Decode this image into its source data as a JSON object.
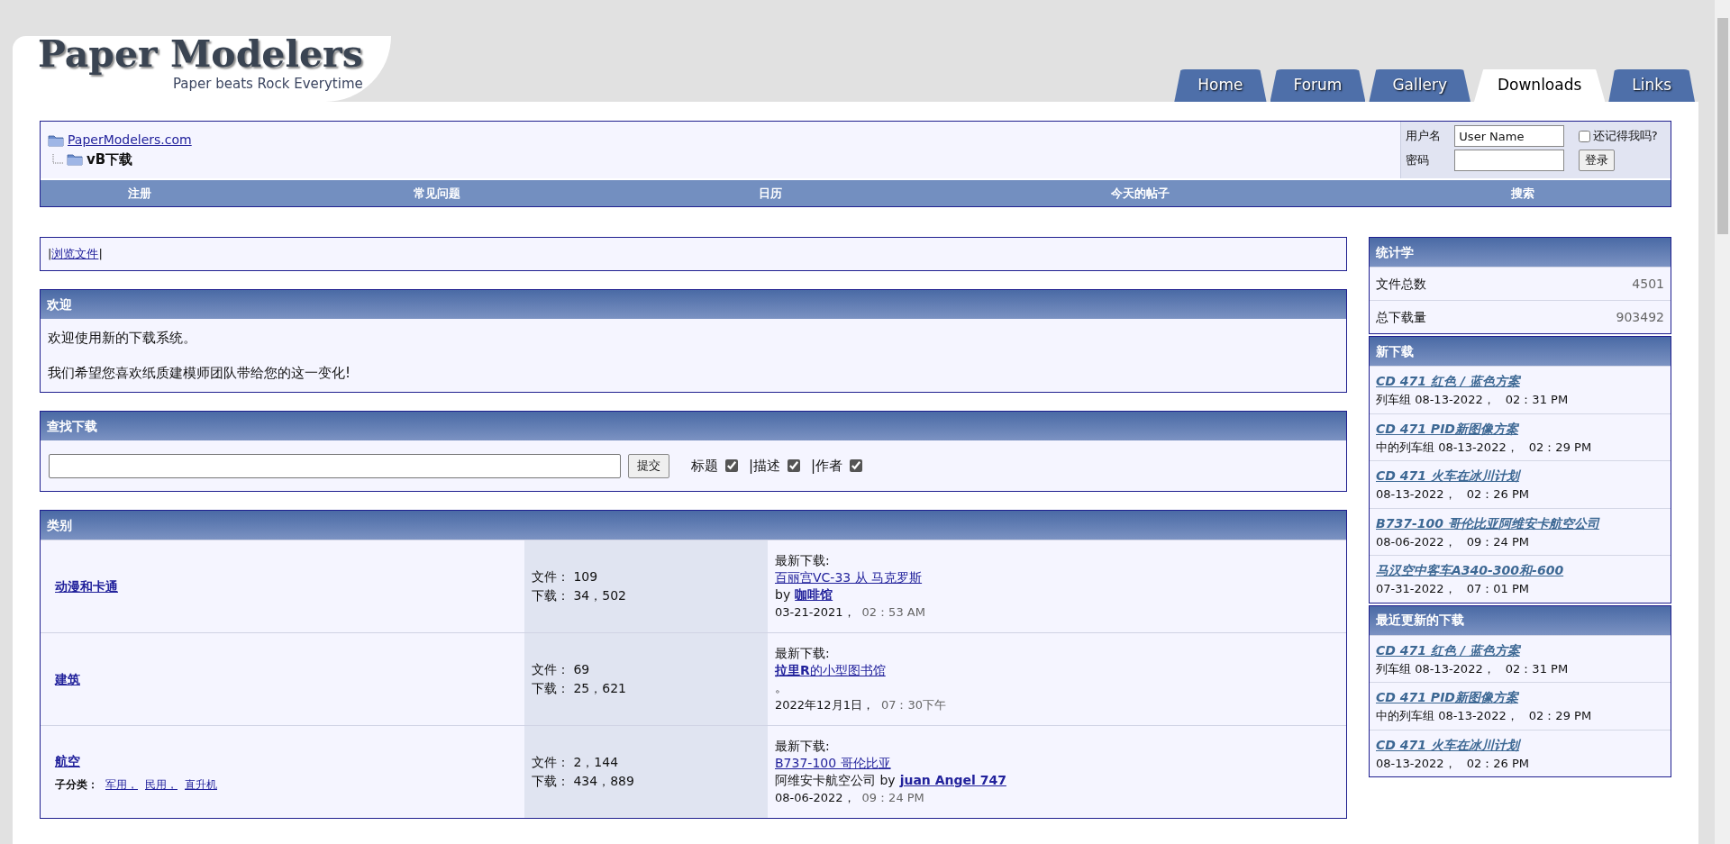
{
  "logo": {
    "title": "Paper Modelers",
    "tagline": "Paper beats Rock Everytime"
  },
  "tabs": [
    {
      "label": "Home",
      "selected": false
    },
    {
      "label": "Forum",
      "selected": false
    },
    {
      "label": "Gallery",
      "selected": false
    },
    {
      "label": "Downloads",
      "selected": true
    },
    {
      "label": "Links",
      "selected": false
    }
  ],
  "breadcrumb": {
    "parent": "PaperModelers.com",
    "current": "vB下载"
  },
  "login": {
    "username_label": "用户名",
    "username_value": "User Name",
    "remember_label": "还记得我吗?",
    "remember_checked": false,
    "password_label": "密码",
    "button": "登录"
  },
  "nav": [
    "注册",
    "常见问题",
    "日历",
    "今天的帖子",
    "搜索"
  ],
  "browse": {
    "separator": "|",
    "link": "浏览文件"
  },
  "welcome": {
    "title": "欢迎",
    "paragraphs": [
      "欢迎使用新的下载系统。",
      "我们希望您喜欢纸质建模师团队带给您的这一变化!"
    ]
  },
  "search": {
    "title": "查找下载",
    "button": "提交",
    "options": [
      {
        "label": "标题",
        "checked": true
      },
      {
        "label": "|描述",
        "checked": true
      },
      {
        "label": "|作者",
        "checked": true
      }
    ]
  },
  "categories": {
    "title": "类别",
    "rows": [
      {
        "name": "动漫和卡通",
        "subcategories_label": "",
        "subcategories": [],
        "files_label": "文件：",
        "files": "109",
        "downloads_label": "下载：",
        "downloads": "34，502",
        "latest_label": "最新下载:",
        "latest_parts": [
          {
            "text": "百丽宫VC-33 从 马克罗斯",
            "bold": false
          }
        ],
        "by_text": "by",
        "author": "咖啡馆",
        "note": "",
        "date": "03-21-2021，",
        "time": "02：53 AM"
      },
      {
        "name": "建筑",
        "subcategories_label": "",
        "subcategories": [],
        "files_label": "文件：",
        "files": "69",
        "downloads_label": "下载：",
        "downloads": "25，621",
        "latest_label": "最新下载:",
        "latest_parts": [
          {
            "text": "拉里R",
            "bold": true
          },
          {
            "text": "的小型图书馆",
            "bold": false
          }
        ],
        "by_text": "",
        "author": "",
        "note": "。",
        "date": "2022年12月1日，",
        "time": "07：30下午"
      },
      {
        "name": "航空",
        "subcategories_label": "子分类：",
        "subcategories": [
          "军用，",
          "民用，",
          "直升机"
        ],
        "files_label": "文件：",
        "files": "2，144",
        "downloads_label": "下载：",
        "downloads": "434，889",
        "latest_label": "最新下载:",
        "latest_parts": [
          {
            "text": "B737-100 哥伦比亚",
            "bold": false
          }
        ],
        "by_text": "阿维安卡航空公司 by",
        "author": "juan Angel 747",
        "note": "",
        "date": "08-06-2022，",
        "time": "09：24 PM"
      }
    ]
  },
  "stats": {
    "title": "统计学",
    "rows": [
      {
        "label": "文件总数",
        "value": "4501"
      },
      {
        "label": "总下载量",
        "value": "903492"
      }
    ]
  },
  "new_downloads": {
    "title": "新下载",
    "items": [
      {
        "title": "CD 471 红色 / 蓝色方案",
        "detail": "列车组 08-13-2022，",
        "time": "02：31 PM"
      },
      {
        "title": "CD 471 PID新图像方案",
        "detail": "中的列车组 08-13-2022，",
        "time": "02：29 PM"
      },
      {
        "title": "CD 471 火车在冰川计划",
        "detail": "08-13-2022，",
        "time": "02：26 PM"
      },
      {
        "title": "B737-100 哥伦比亚阿维安卡航空公司",
        "detail": "08-06-2022，",
        "time": "09：24 PM"
      },
      {
        "title": "马汉空中客车A340-300和-600",
        "detail": "07-31-2022，",
        "time": "07：01 PM"
      }
    ]
  },
  "recent_downloads": {
    "title": "最近更新的下载",
    "items": [
      {
        "title": "CD 471 红色 / 蓝色方案",
        "detail": "列车组 08-13-2022，",
        "time": "02：31 PM"
      },
      {
        "title": "CD 471 PID新图像方案",
        "detail": "中的列车组 08-13-2022，",
        "time": "02：29 PM"
      },
      {
        "title": "CD 471 火车在冰川计划",
        "detail": "08-13-2022，",
        "time": "02：26 PM"
      }
    ]
  }
}
